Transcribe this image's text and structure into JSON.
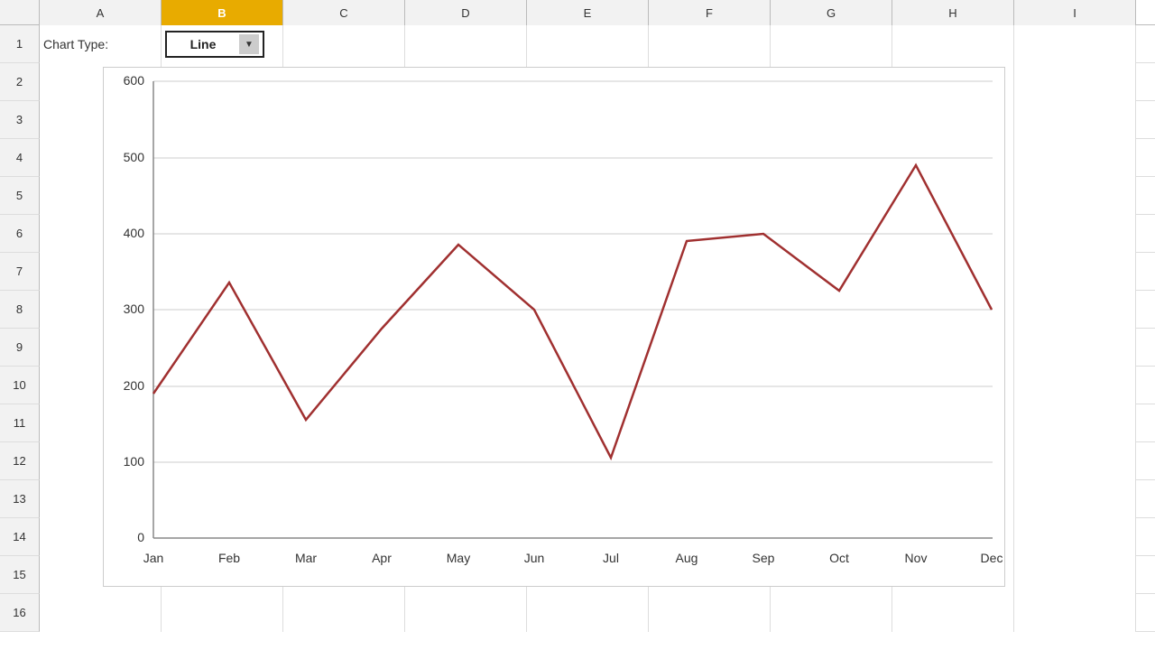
{
  "columns": {
    "headers": [
      "A",
      "B",
      "C",
      "D",
      "E",
      "F",
      "G",
      "H",
      "I"
    ]
  },
  "rows": {
    "headers": [
      "1",
      "2",
      "3",
      "4",
      "5",
      "6",
      "7",
      "8",
      "9",
      "10",
      "11",
      "12",
      "13",
      "14",
      "15",
      "16"
    ]
  },
  "row1": {
    "label": "Chart Type:",
    "dropdown_value": "Line",
    "dropdown_arrow": "▼"
  },
  "chart": {
    "y_axis_labels": [
      "0",
      "100",
      "200",
      "300",
      "400",
      "500",
      "600"
    ],
    "x_axis_labels": [
      "Jan",
      "Feb",
      "Mar",
      "Apr",
      "May",
      "Jun",
      "Jul",
      "Aug",
      "Sep",
      "Oct",
      "Nov",
      "Dec"
    ],
    "data_points": [
      {
        "month": "Jan",
        "value": 190
      },
      {
        "month": "Feb",
        "value": 335
      },
      {
        "month": "Mar",
        "value": 155
      },
      {
        "month": "Apr",
        "value": 275
      },
      {
        "month": "May",
        "value": 385
      },
      {
        "month": "Jun",
        "value": 300
      },
      {
        "month": "Jul",
        "value": 105
      },
      {
        "month": "Aug",
        "value": 390
      },
      {
        "month": "Sep",
        "value": 400
      },
      {
        "month": "Oct",
        "value": 325
      },
      {
        "month": "Nov",
        "value": 490
      },
      {
        "month": "Dec",
        "value": 300
      }
    ]
  }
}
